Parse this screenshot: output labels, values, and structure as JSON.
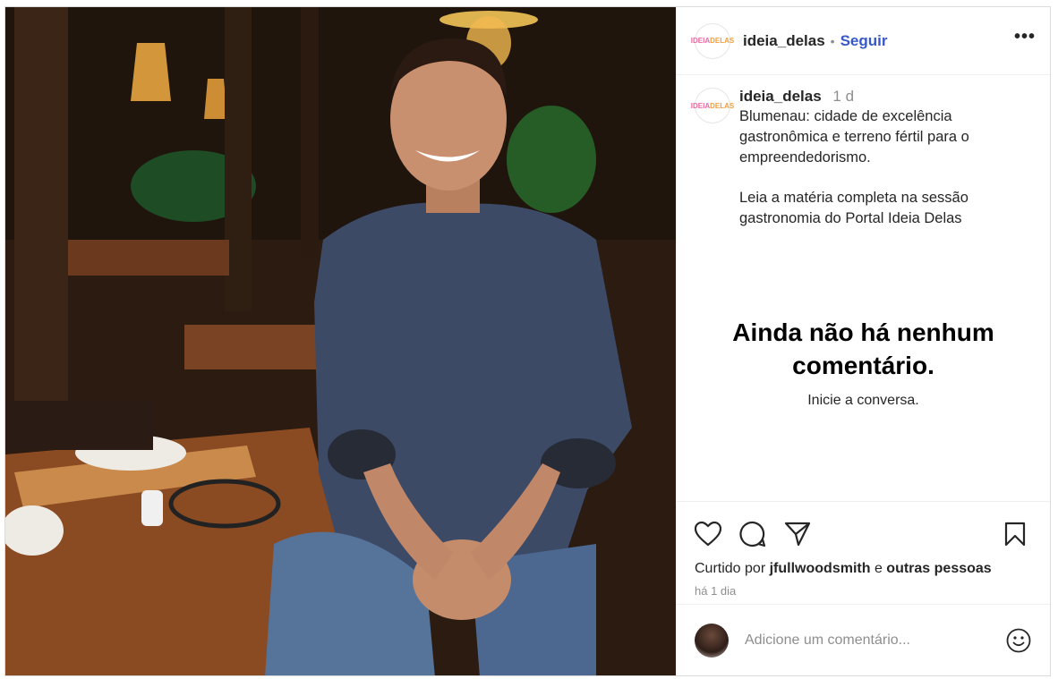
{
  "post": {
    "username": "ideia_delas",
    "follow_label": "Seguir",
    "separator": "•",
    "more_label": "•••",
    "logo": {
      "part1": "IDEIA",
      "part2": "DELAS"
    },
    "caption": {
      "username": "ideia_delas",
      "time": "1 d",
      "paragraph1": "Blumenau: cidade de excelência gastronômica e terreno fértil para o empreendedorismo.",
      "paragraph2": "Leia a matéria completa na sessão gastronomia do Portal Ideia Delas"
    },
    "empty_state": {
      "title": "Ainda não há nenhum comentário.",
      "subtitle": "Inicie a conversa."
    },
    "likes": {
      "prefix": "Curtido por",
      "user": "jfullwoodsmith",
      "connector": "e",
      "others": "outras pessoas"
    },
    "date": "há 1 dia",
    "comment_placeholder": "Adicione um comentário..."
  },
  "icons": [
    "heart-icon",
    "comment-icon",
    "share-icon",
    "bookmark-icon",
    "emoji-icon",
    "more-icon"
  ],
  "colors": {
    "follow": "#3858c9",
    "muted": "#8e8e8e",
    "text": "#262626"
  }
}
